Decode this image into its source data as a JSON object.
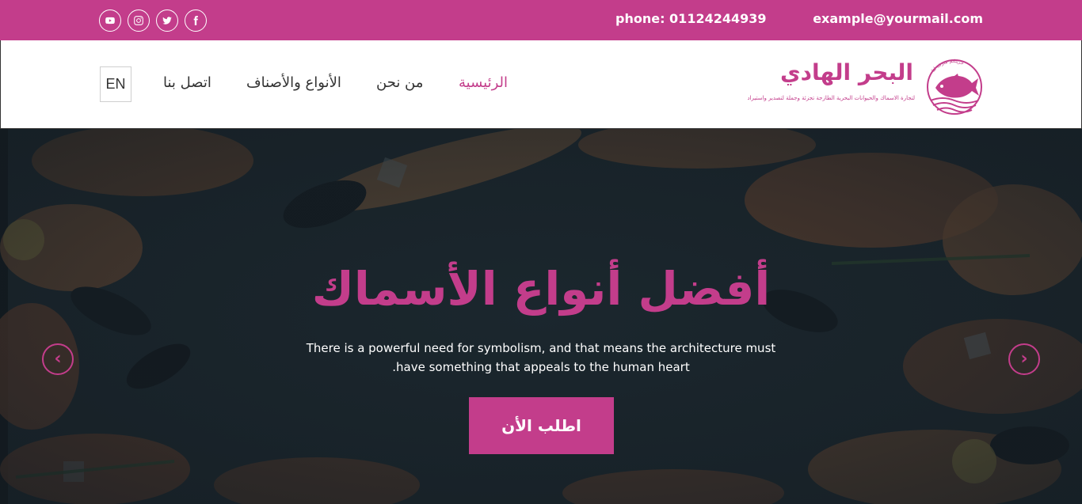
{
  "topbar": {
    "phone": "phone: 01124244939",
    "email": "example@yourmail.com",
    "social": [
      "youtube-icon",
      "instagram-icon",
      "twitter-icon",
      "facebook-icon"
    ]
  },
  "nav": {
    "lang": "EN",
    "links": {
      "home": "الرئيسية",
      "about": "من نحن",
      "types": "الأنواع والأصناف",
      "contact": "اتصل بنا"
    }
  },
  "logo": {
    "title": "البحر الهادي",
    "subtitle": "لتجارة الاسماك والحيوانات البحرية الطازجة تجزئة وجملة لتصدير واستيراد",
    "ring_text": "جربتكم شرف لنا"
  },
  "hero": {
    "title": "أفضل أنواع الأسماك",
    "text_line1": "There is a powerful need for symbolism, and that means the architecture must",
    "text_line2": ".have something that appeals to the human heart",
    "cta": "اطلب الأن",
    "prev": "‹",
    "next": "›"
  },
  "colors": {
    "accent": "#c33d8b",
    "hero_bg": "#1f2c33"
  }
}
